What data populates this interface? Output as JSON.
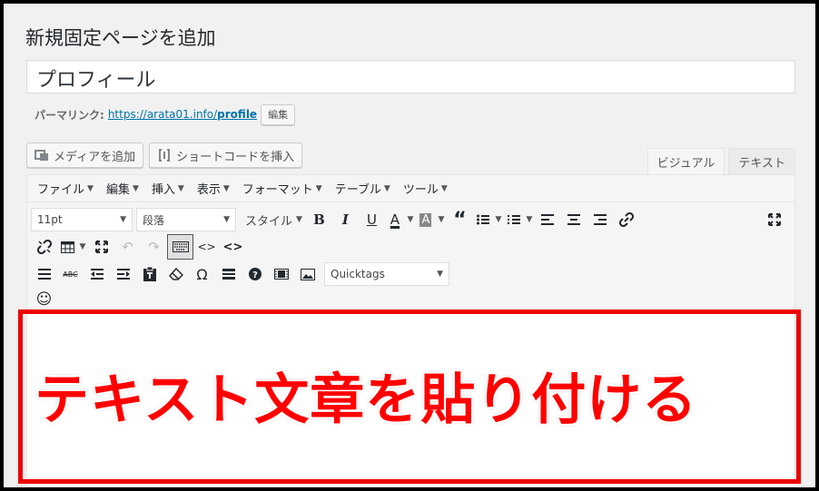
{
  "page": {
    "title": "新規固定ページを追加"
  },
  "post": {
    "title_value": "プロフィール"
  },
  "permalink": {
    "label": "パーマリンク:",
    "url_base": "https://arata01.info/",
    "slug": "profile",
    "edit_label": "編集"
  },
  "media": {
    "add_media_label": "メディアを追加",
    "shortcode_label": "ショートコードを挿入"
  },
  "tabs": {
    "visual": "ビジュアル",
    "text": "テキスト"
  },
  "menubar": [
    {
      "label": "ファイル"
    },
    {
      "label": "編集"
    },
    {
      "label": "挿入"
    },
    {
      "label": "表示"
    },
    {
      "label": "フォーマット"
    },
    {
      "label": "テーブル"
    },
    {
      "label": "ツール"
    }
  ],
  "toolbar": {
    "font_size": "11pt",
    "block_format": "段落",
    "style_label": "スタイル",
    "bold": "B",
    "italic": "I",
    "underline": "U",
    "text_color": "A",
    "bg_color": "A",
    "quicktags": "Quicktags",
    "omega": "Ω",
    "code1": "<>",
    "code2": "<>",
    "strike": "ABC"
  },
  "annotation": {
    "text": "テキスト文章を貼り付ける",
    "color": "#ff0000"
  }
}
